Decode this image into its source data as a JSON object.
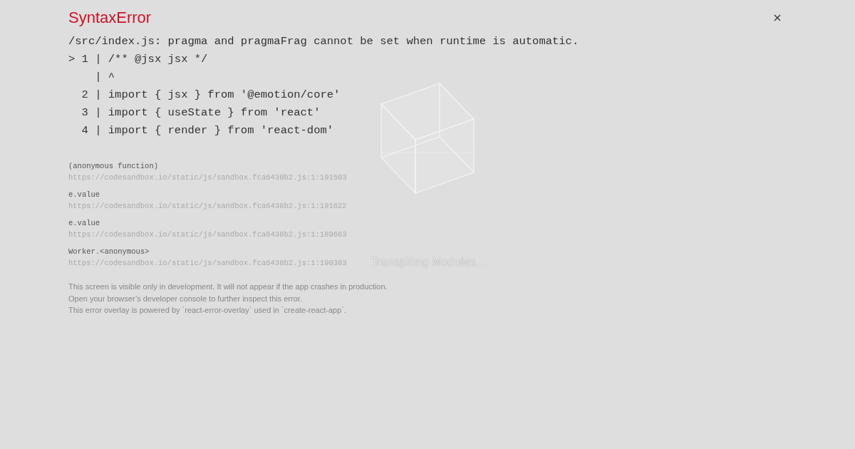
{
  "error": {
    "title": "SyntaxError",
    "message": "/src/index.js: pragma and pragmaFrag cannot be set when runtime is automatic.",
    "code_lines": [
      "> 1 | /** @jsx jsx */",
      "    | ^",
      "  2 | import { jsx } from '@emotion/core'",
      "  3 | import { useState } from 'react'",
      "  4 | import { render } from 'react-dom'"
    ]
  },
  "stack": [
    {
      "function": "(anonymous function)",
      "location": "https://codesandbox.io/static/js/sandbox.fca6438b2.js:1:191503"
    },
    {
      "function": "e.value",
      "location": "https://codesandbox.io/static/js/sandbox.fca6438b2.js:1:191622"
    },
    {
      "function": "e.value",
      "location": "https://codesandbox.io/static/js/sandbox.fca6438b2.js:1:189663"
    },
    {
      "function": "Worker.<anonymous>",
      "location": "https://codesandbox.io/static/js/sandbox.fca6438b2.js:1:190383"
    }
  ],
  "footer": [
    "This screen is visible only in development. It will not appear if the app crashes in production.",
    "Open your browser’s developer console to further inspect this error.",
    "This error overlay is powered by `react-error-overlay` used in `create-react-app`."
  ],
  "loader": {
    "label": "Transpiling Modules..."
  }
}
